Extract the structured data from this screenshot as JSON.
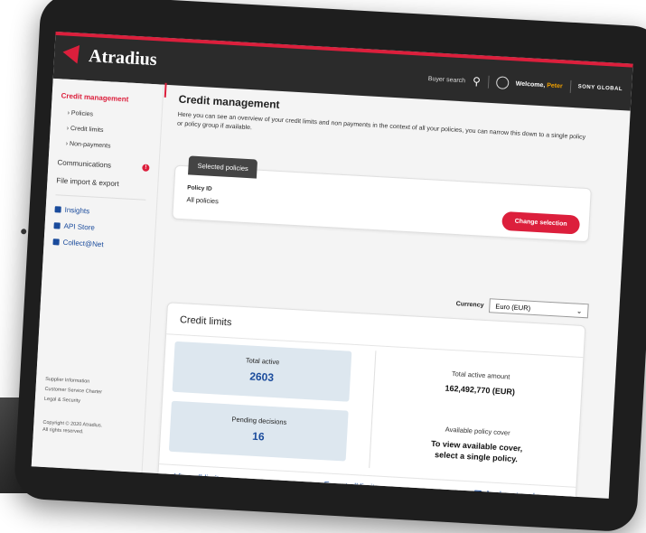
{
  "brand": {
    "name": "Atradius"
  },
  "topnav": {
    "buyer_search": "Buyer search",
    "welcome_prefix": "Welcome,",
    "user_name": "Peter",
    "company": "SONY GLOBAL"
  },
  "sidebar": {
    "credit_management": "Credit management",
    "policies": "Policies",
    "credit_limits": "Credit limits",
    "non_payments": "Non-payments",
    "communications": "Communications",
    "communications_badge": "!",
    "file_import_export": "File import & export",
    "insights": "Insights",
    "api_store": "API Store",
    "collect_net": "Collect@Net",
    "footer_links": [
      "Supplier Information",
      "Customer Service Charter",
      "Legal & Security"
    ],
    "copyright": [
      "Copyright © 2020 Atradius.",
      "All rights reserved."
    ]
  },
  "main": {
    "title": "Credit management",
    "description": "Here you can see an overview of your credit limits and non payments in the context of all your policies, you can narrow this down to a single policy or policy group if available.",
    "selected_policies": {
      "tab_label": "Selected policies",
      "policy_id_label": "Policy ID",
      "policy_id_value": "All policies",
      "change_button": "Change selection"
    },
    "currency": {
      "label": "Currency",
      "value": "Euro (EUR)"
    },
    "credit_limits": {
      "title": "Credit limits",
      "total_active_label": "Total active",
      "total_active_value": "2603",
      "pending_label": "Pending decisions",
      "pending_value": "16",
      "total_amount_label": "Total active amount",
      "total_amount_value": "162,492,770 (EUR)",
      "policy_cover_label": "Available policy cover",
      "policy_cover_value_line1": "To view available cover,",
      "policy_cover_value_line2": "select a single policy.",
      "view_all": "View all limits",
      "export_all": "Export all limits",
      "analyse": "Analyse trends"
    }
  }
}
